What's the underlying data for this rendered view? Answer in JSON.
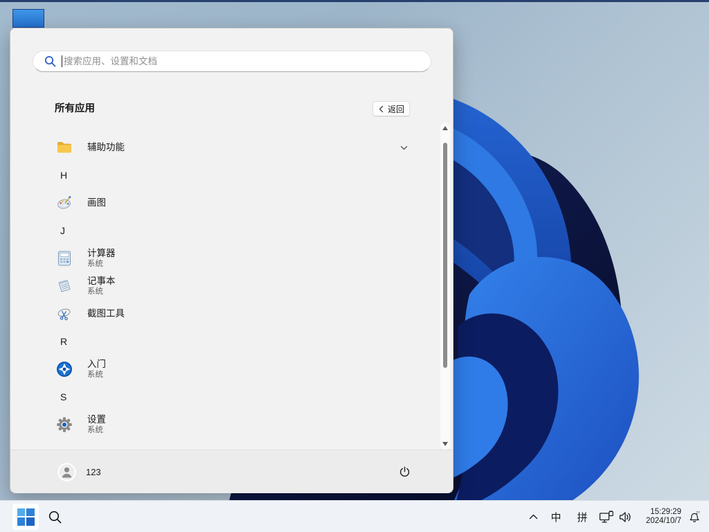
{
  "colors": {
    "accent_blue": "#0067c0",
    "menu_bg": "#f2f2f2",
    "taskbar_bg": "#eff3f8",
    "folder_yellow": "#f2c14b",
    "bloom_bright_blue": "#2f7de8",
    "bloom_dark_navy": "#0d1648",
    "search_icon_blue": "#2456c4"
  },
  "start_menu": {
    "search_placeholder": "搜索应用、设置和文档",
    "header": "所有应用",
    "back_label": "返回",
    "items": [
      {
        "type": "folder",
        "label": "辅助功能",
        "icon": "folder-icon"
      },
      {
        "type": "letter",
        "label": "H"
      },
      {
        "type": "app",
        "label": "画图",
        "icon": "paint-icon"
      },
      {
        "type": "letter",
        "label": "J"
      },
      {
        "type": "app",
        "label": "计算器",
        "sublabel": "系统",
        "icon": "calculator-icon"
      },
      {
        "type": "app",
        "label": "记事本",
        "sublabel": "系统",
        "icon": "notepad-icon"
      },
      {
        "type": "app",
        "label": "截图工具",
        "icon": "snipping-tool-icon"
      },
      {
        "type": "letter",
        "label": "R"
      },
      {
        "type": "app",
        "label": "入门",
        "sublabel": "系统",
        "icon": "get-started-icon"
      },
      {
        "type": "letter",
        "label": "S"
      },
      {
        "type": "app",
        "label": "设置",
        "sublabel": "系统",
        "icon": "settings-icon"
      }
    ],
    "user": {
      "name": "123"
    }
  },
  "taskbar": {
    "tray": {
      "ime_language": "中",
      "ime_mode": "拼",
      "time": "15:29:29",
      "date": "2024/10/7"
    }
  }
}
